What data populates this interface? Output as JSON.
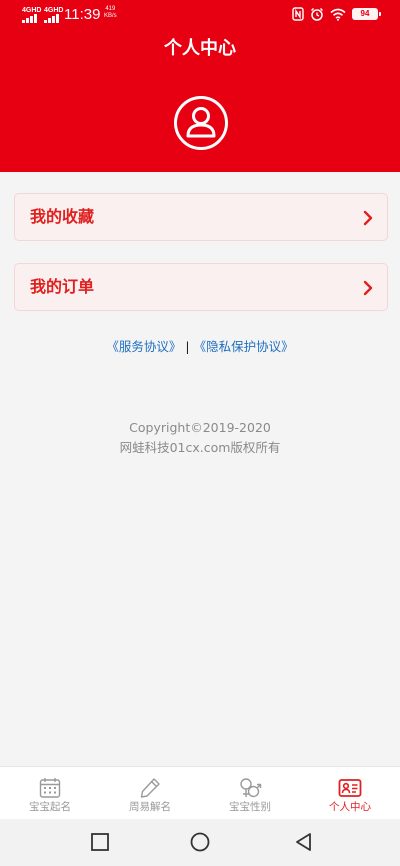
{
  "status_bar": {
    "network_1": "4GHD",
    "network_2": "4GHD",
    "time": "11:39",
    "speed_value": "419",
    "speed_unit": "KB/s",
    "battery": "94"
  },
  "header": {
    "title": "个人中心",
    "avatar_icon": "user-avatar-icon"
  },
  "menu": {
    "items": [
      {
        "label": "我的收藏",
        "icon": "chevron-right-icon"
      },
      {
        "label": "我的订单",
        "icon": "chevron-right-icon"
      }
    ]
  },
  "agreements": {
    "service": "《服务协议》",
    "separator": "|",
    "privacy": "《隐私保护协议》"
  },
  "footer": {
    "copyright": "Copyright©2019-2020",
    "owner": "网蛙科技01cx.com版权所有"
  },
  "tabs": [
    {
      "label": "宝宝起名",
      "icon": "calendar-icon",
      "active": false
    },
    {
      "label": "周易解名",
      "icon": "pencil-icon",
      "active": false
    },
    {
      "label": "宝宝性别",
      "icon": "gender-icon",
      "active": false
    },
    {
      "label": "个人中心",
      "icon": "id-card-icon",
      "active": true
    }
  ],
  "colors": {
    "brand_red": "#e60012",
    "accent_text": "#e0201f",
    "link_blue": "#1f6fc0",
    "inactive_tab": "#9a9a9a"
  }
}
